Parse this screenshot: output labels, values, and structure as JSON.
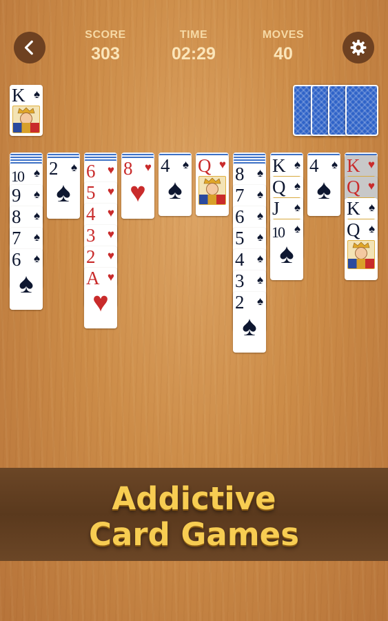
{
  "header": {
    "score": {
      "label": "SCORE",
      "value": "303"
    },
    "time": {
      "label": "TIME",
      "value": "02:29"
    },
    "moves": {
      "label": "MOVES",
      "value": "40"
    }
  },
  "icons": {
    "back": "chevron-left-icon",
    "settings": "gear-icon"
  },
  "colors": {
    "red_suit": "#c92b2b",
    "black_suit": "#0e1730",
    "card_back": "#2f63c8",
    "banner_text": "#f7cd52"
  },
  "completed_pile": {
    "rank": "K",
    "suit": "♠"
  },
  "stock_remaining_stacks": 4,
  "tableau": [
    {
      "face_down": 4,
      "cards": [
        {
          "rank": "10",
          "suit": "♠"
        },
        {
          "rank": "9",
          "suit": "♠"
        },
        {
          "rank": "8",
          "suit": "♠"
        },
        {
          "rank": "7",
          "suit": "♠"
        },
        {
          "rank": "6",
          "suit": "♠"
        }
      ]
    },
    {
      "face_down": 2,
      "cards": [
        {
          "rank": "2",
          "suit": "♠"
        }
      ]
    },
    {
      "face_down": 3,
      "cards": [
        {
          "rank": "6",
          "suit": "♥"
        },
        {
          "rank": "5",
          "suit": "♥"
        },
        {
          "rank": "4",
          "suit": "♥"
        },
        {
          "rank": "3",
          "suit": "♥"
        },
        {
          "rank": "2",
          "suit": "♥"
        },
        {
          "rank": "A",
          "suit": "♥"
        }
      ]
    },
    {
      "face_down": 2,
      "cards": [
        {
          "rank": "8",
          "suit": "♥"
        }
      ]
    },
    {
      "face_down": 1,
      "cards": [
        {
          "rank": "4",
          "suit": "♠"
        }
      ]
    },
    {
      "face_down": 1,
      "cards": [
        {
          "rank": "Q",
          "suit": "♥"
        }
      ]
    },
    {
      "face_down": 4,
      "cards": [
        {
          "rank": "8",
          "suit": "♠"
        },
        {
          "rank": "7",
          "suit": "♠"
        },
        {
          "rank": "6",
          "suit": "♠"
        },
        {
          "rank": "5",
          "suit": "♠"
        },
        {
          "rank": "4",
          "suit": "♠"
        },
        {
          "rank": "3",
          "suit": "♠"
        },
        {
          "rank": "2",
          "suit": "♠"
        }
      ]
    },
    {
      "face_down": 1,
      "cards": [
        {
          "rank": "K",
          "suit": "♠"
        },
        {
          "rank": "Q",
          "suit": "♠"
        },
        {
          "rank": "J",
          "suit": "♠"
        },
        {
          "rank": "10",
          "suit": "♠"
        }
      ]
    },
    {
      "face_down": 1,
      "cards": [
        {
          "rank": "4",
          "suit": "♠"
        }
      ]
    },
    {
      "face_down": 1,
      "cards": [
        {
          "rank": "K",
          "suit": "♥",
          "dim": true
        },
        {
          "rank": "Q",
          "suit": "♥",
          "dim": true
        },
        {
          "rank": "K",
          "suit": "♠"
        },
        {
          "rank": "Q",
          "suit": "♠"
        }
      ]
    }
  ],
  "banner": {
    "line1": "Addictive",
    "line2": "Card Games"
  }
}
